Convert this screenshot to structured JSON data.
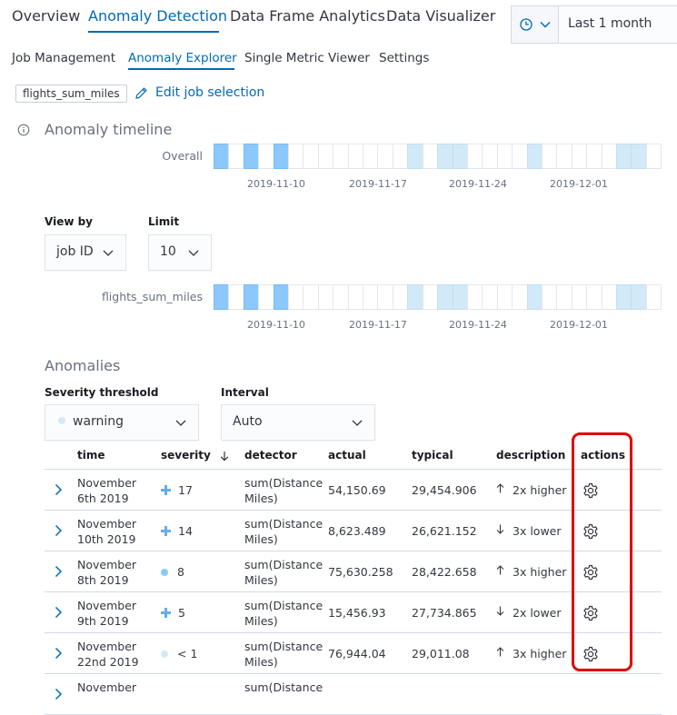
{
  "nav": {
    "tabs": [
      "Overview",
      "Anomaly Detection",
      "Data Frame Analytics",
      "Data Visualizer"
    ],
    "active_tab": "Anomaly Detection"
  },
  "date_picker": {
    "value": "Last 1 month",
    "quick_menu_icon": "clock-icon"
  },
  "sub_nav": {
    "tabs": [
      "Job Management",
      "Anomaly Explorer",
      "Single Metric Viewer",
      "Settings"
    ],
    "active_tab": "Anomaly Explorer"
  },
  "job_selection": {
    "badge": "flights_sum_miles",
    "edit_label": "Edit job selection"
  },
  "timeline": {
    "title": "Anomaly timeline",
    "overall_label": "Overall",
    "axis_labels": [
      "2019-11-10",
      "2019-11-17",
      "2019-11-24",
      "2019-12-01"
    ],
    "cell_count": 30,
    "overall_cells": [
      2,
      0,
      2,
      0,
      2,
      0,
      0,
      0,
      0,
      0,
      0,
      0,
      0,
      1,
      0,
      1,
      1,
      0,
      0,
      0,
      0,
      1,
      0,
      0,
      0,
      0,
      0,
      1,
      1,
      0,
      0,
      0,
      0,
      0,
      0,
      0,
      0,
      0,
      0,
      0
    ],
    "view_by_label": "View by",
    "view_by_value": "job ID",
    "limit_label": "Limit",
    "limit_value": "10",
    "lane_label": "flights_sum_miles",
    "lane_cells": [
      2,
      0,
      2,
      0,
      2,
      0,
      0,
      0,
      0,
      0,
      0,
      0,
      0,
      1,
      0,
      1,
      1,
      0,
      0,
      0,
      0,
      1,
      0,
      0,
      0,
      0,
      0,
      1,
      1,
      0,
      0,
      0,
      0,
      0,
      0,
      0,
      0,
      0,
      0,
      0
    ]
  },
  "anomalies": {
    "title": "Anomalies",
    "severity_label": "Severity threshold",
    "severity_value": "warning",
    "interval_label": "Interval",
    "interval_value": "Auto",
    "columns": {
      "time": "time",
      "severity": "severity",
      "detector": "detector",
      "actual": "actual",
      "typical": "typical",
      "description": "description",
      "actions": "actions"
    },
    "rows": [
      {
        "time": "November 6th 2019",
        "severity": "17",
        "sev_type": "plus",
        "detector": "sum(Distance Miles)",
        "actual": "54,150.69",
        "typical": "29,454.906",
        "direction": "up",
        "description": "2x higher"
      },
      {
        "time": "November 10th 2019",
        "severity": "14",
        "sev_type": "plus",
        "detector": "sum(Distance Miles)",
        "actual": "8,623.489",
        "typical": "26,621.152",
        "direction": "down",
        "description": "3x lower"
      },
      {
        "time": "November 8th 2019",
        "severity": "8",
        "sev_type": "circle",
        "detector": "sum(Distance Miles)",
        "actual": "75,630.258",
        "typical": "28,422.658",
        "direction": "up",
        "description": "3x higher"
      },
      {
        "time": "November 9th 2019",
        "severity": "5",
        "sev_type": "plus",
        "detector": "sum(Distance Miles)",
        "actual": "15,456.93",
        "typical": "27,734.865",
        "direction": "down",
        "description": "2x lower"
      },
      {
        "time": "November 22nd 2019",
        "severity": "< 1",
        "sev_type": "circle-low",
        "detector": "sum(Distance Miles)",
        "actual": "76,944.04",
        "typical": "29,011.08",
        "direction": "up",
        "description": "3x higher"
      },
      {
        "time": "November",
        "severity": "",
        "sev_type": "none",
        "detector": "sum(Distance",
        "actual": "",
        "typical": "",
        "direction": "",
        "description": ""
      }
    ],
    "colors": {
      "severity_high": "#8bc8fb",
      "severity_low": "#d2e9f7",
      "accent": "#006bb4",
      "highlight": "#e00000"
    }
  }
}
